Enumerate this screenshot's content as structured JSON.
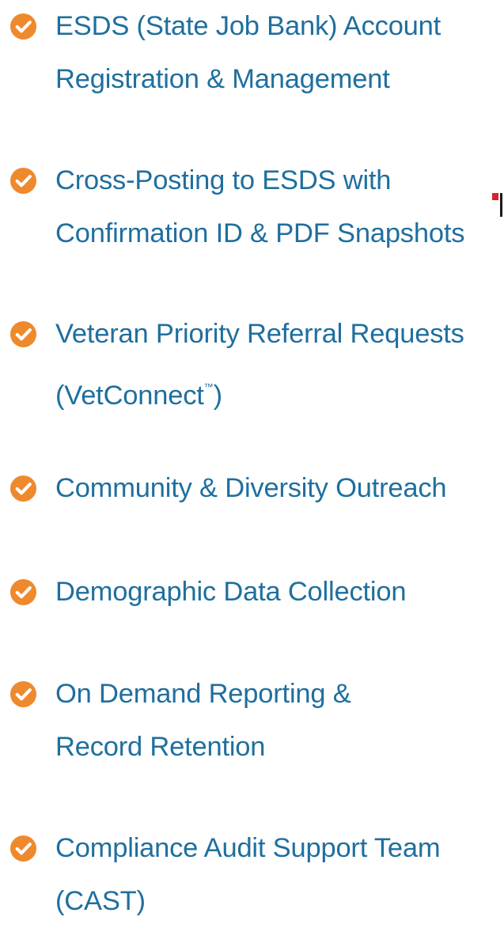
{
  "colors": {
    "text": "#1f6f9e",
    "check_circle": "#ee8a2d",
    "check_mark": "#ffffff"
  },
  "icon": "check-circle-icon",
  "features": [
    {
      "lines": [
        "ESDS (State Job Bank) Account",
        "Registration & Management"
      ]
    },
    {
      "lines": [
        "Cross-Posting to ESDS with",
        "Confirmation ID & PDF Snapshots"
      ]
    },
    {
      "lines": [
        "Veteran Priority Referral Requests",
        "(VetConnect"
      ],
      "trademark": "™",
      "suffix": ")"
    },
    {
      "lines": [
        "Community & Diversity Outreach"
      ]
    },
    {
      "lines": [
        "Demographic Data Collection"
      ]
    },
    {
      "lines": [
        "On Demand Reporting &",
        "Record Retention"
      ]
    },
    {
      "lines": [
        "Compliance Audit Support Team",
        "(CAST)"
      ]
    }
  ]
}
